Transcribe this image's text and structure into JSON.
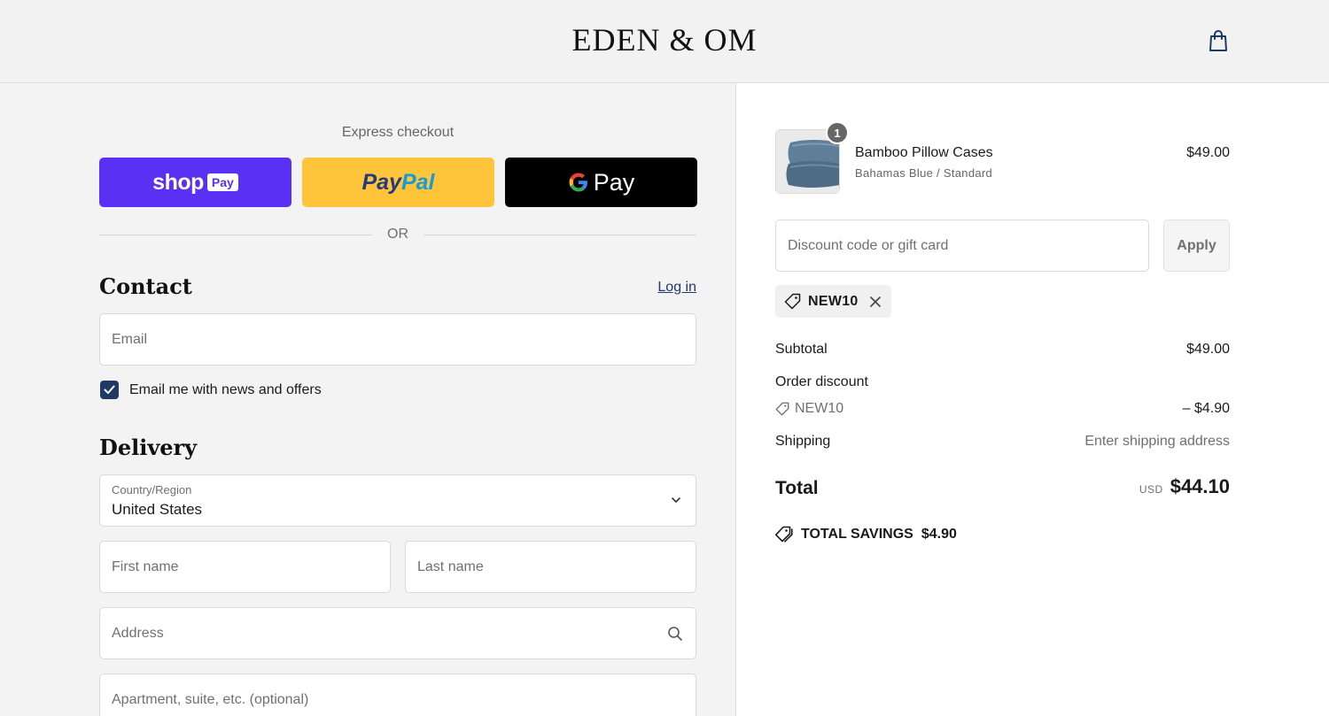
{
  "header": {
    "logo": "EDEN & OM"
  },
  "express": {
    "title": "Express checkout",
    "shop_pay": {
      "word": "shop",
      "badge": "Pay"
    },
    "paypal": {
      "part1": "Pay",
      "part2": "Pal"
    },
    "gpay": {
      "word": "Pay"
    },
    "or_text": "OR"
  },
  "contact": {
    "title": "Contact",
    "login_label": "Log in",
    "email_placeholder": "Email",
    "newsletter_label": "Email me with news and offers"
  },
  "delivery": {
    "title": "Delivery",
    "country_label": "Country/Region",
    "country_value": "United States",
    "first_name_placeholder": "First name",
    "last_name_placeholder": "Last name",
    "address_placeholder": "Address",
    "apartment_placeholder": "Apartment, suite, etc. (optional)"
  },
  "summary": {
    "product": {
      "name": "Bamboo Pillow Cases",
      "variant": "Bahamas Blue / Standard",
      "price": "$49.00",
      "quantity": "1"
    },
    "discount_placeholder": "Discount code or gift card",
    "apply_label": "Apply",
    "applied_code": "NEW10",
    "subtotal_label": "Subtotal",
    "subtotal_value": "$49.00",
    "order_discount_label": "Order discount",
    "discount_code": "NEW10",
    "discount_value": "– $4.90",
    "shipping_label": "Shipping",
    "shipping_value": "Enter shipping address",
    "total_label": "Total",
    "currency": "USD",
    "total_value": "$44.10",
    "savings_label": "TOTAL SAVINGS",
    "savings_value": "$4.90"
  },
  "colors": {
    "shop_pay": "#5a31f4",
    "paypal": "#ffc439",
    "gpay": "#000000",
    "accent": "#1f3a64"
  }
}
